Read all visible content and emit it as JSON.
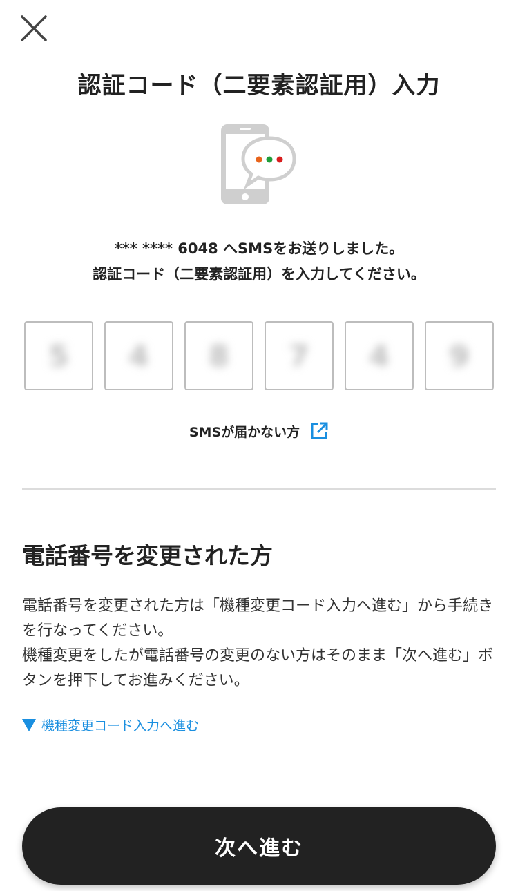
{
  "header": {
    "close_icon": "close-icon",
    "title": "認証コード（二要素認証用）入力"
  },
  "illustration": {
    "icon": "phone-sms-icon",
    "dot_colors": [
      "#e8641b",
      "#1f9e3a",
      "#d81d1d"
    ]
  },
  "message": {
    "line1": "*** **** 6048 へSMSをお送りしました。",
    "line2": "認証コード（二要素認証用）を入力してください。"
  },
  "code_inputs": [
    "5",
    "4",
    "8",
    "7",
    "4",
    "9"
  ],
  "no_sms": {
    "label": "SMSが届かない方",
    "icon": "external-link-icon"
  },
  "phone_change": {
    "heading": "電話番号を変更された方",
    "paragraph1": "電話番号を変更された方は「機種変更コード入力へ進む」から手続きを行なってください。",
    "paragraph2": "機種変更をしたが電話番号の変更のない方はそのまま「次へ進む」ボタンを押下してお進みください。",
    "link_label": "機種変更コード入力へ進む",
    "link_color": "#1a8fe0"
  },
  "footer": {
    "next_label": "次へ進む",
    "button_color": "#222222"
  }
}
